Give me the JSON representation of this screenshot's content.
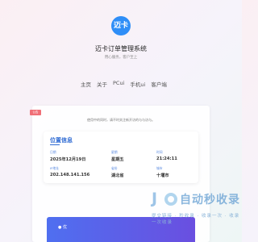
{
  "header": {
    "logo_text": "迈卡",
    "title": "迈卡订单管理系统",
    "subtitle": "用心服务，客户至上",
    "nav": [
      "主页",
      "关于",
      "PCui",
      "手机ui",
      "客户端"
    ]
  },
  "panel": {
    "tag": "公告",
    "tip": "使用中的同时，请不时关注新开访的与与访与。",
    "location": {
      "title": "位置信息",
      "fields": [
        {
          "label": "日期",
          "value": "2025年12月19日"
        },
        {
          "label": "星期",
          "value": "星期五"
        },
        {
          "label": "时间",
          "value": "21:24:11"
        },
        {
          "label": "IP地址",
          "value": "202.148.141.156"
        },
        {
          "label": "省份",
          "value": "湖北省"
        },
        {
          "label": "城市",
          "value": "十堰市"
        }
      ]
    },
    "bottom_bar_text": "● 优"
  },
  "watermark": {
    "big": "自动秒收录",
    "small": "提交链接 · 秒收录 · 收录一次 · 收录一次收录"
  },
  "colors": {
    "accent": "#2f8ef7",
    "tag": "#f06f77",
    "card_title": "#2f6bd3",
    "bar_start": "#4f6ff0",
    "bar_end": "#6a4fe0"
  }
}
